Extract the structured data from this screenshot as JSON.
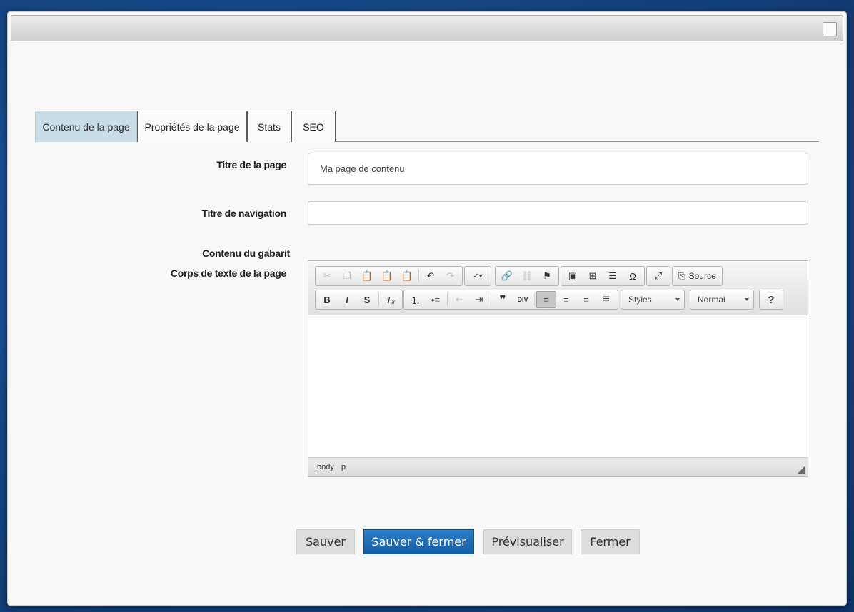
{
  "tabs": [
    "Contenu de la page",
    "Propriétés de la page",
    "Stats",
    "SEO"
  ],
  "form": {
    "title_label": "Titre de la page",
    "title_value": "Ma page de contenu",
    "nav_label": "Titre de navigation",
    "nav_value": "",
    "template_label": "Contenu du gabarit",
    "body_label": "Corps de texte de la page"
  },
  "editor": {
    "source_label": "Source",
    "styles_label": "Styles",
    "format_label": "Normal",
    "path": [
      "body",
      "p"
    ]
  },
  "buttons": {
    "save": "Sauver",
    "save_close": "Sauver & fermer",
    "preview": "Prévisualiser",
    "close": "Fermer"
  }
}
